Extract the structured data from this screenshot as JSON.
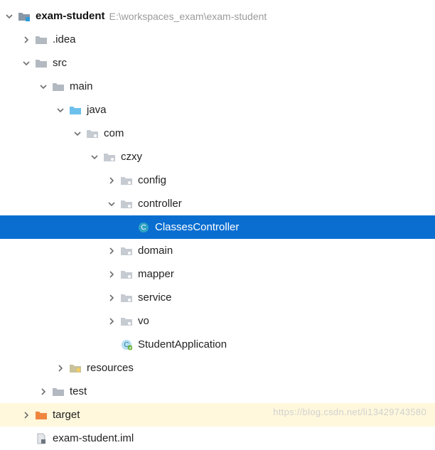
{
  "root": {
    "name": "exam-student",
    "path": "E:\\workspaces_exam\\exam-student"
  },
  "nodes": {
    "idea": ".idea",
    "src": "src",
    "main": "main",
    "java": "java",
    "com": "com",
    "czxy": "czxy",
    "config": "config",
    "controller": "controller",
    "classesController": "ClassesController",
    "domain": "domain",
    "mapper": "mapper",
    "service": "service",
    "vo": "vo",
    "studentApplication": "StudentApplication",
    "resources": "resources",
    "test": "test",
    "target": "target",
    "iml": "exam-student.iml"
  },
  "watermark": "https://blog.csdn.net/li13429743580"
}
